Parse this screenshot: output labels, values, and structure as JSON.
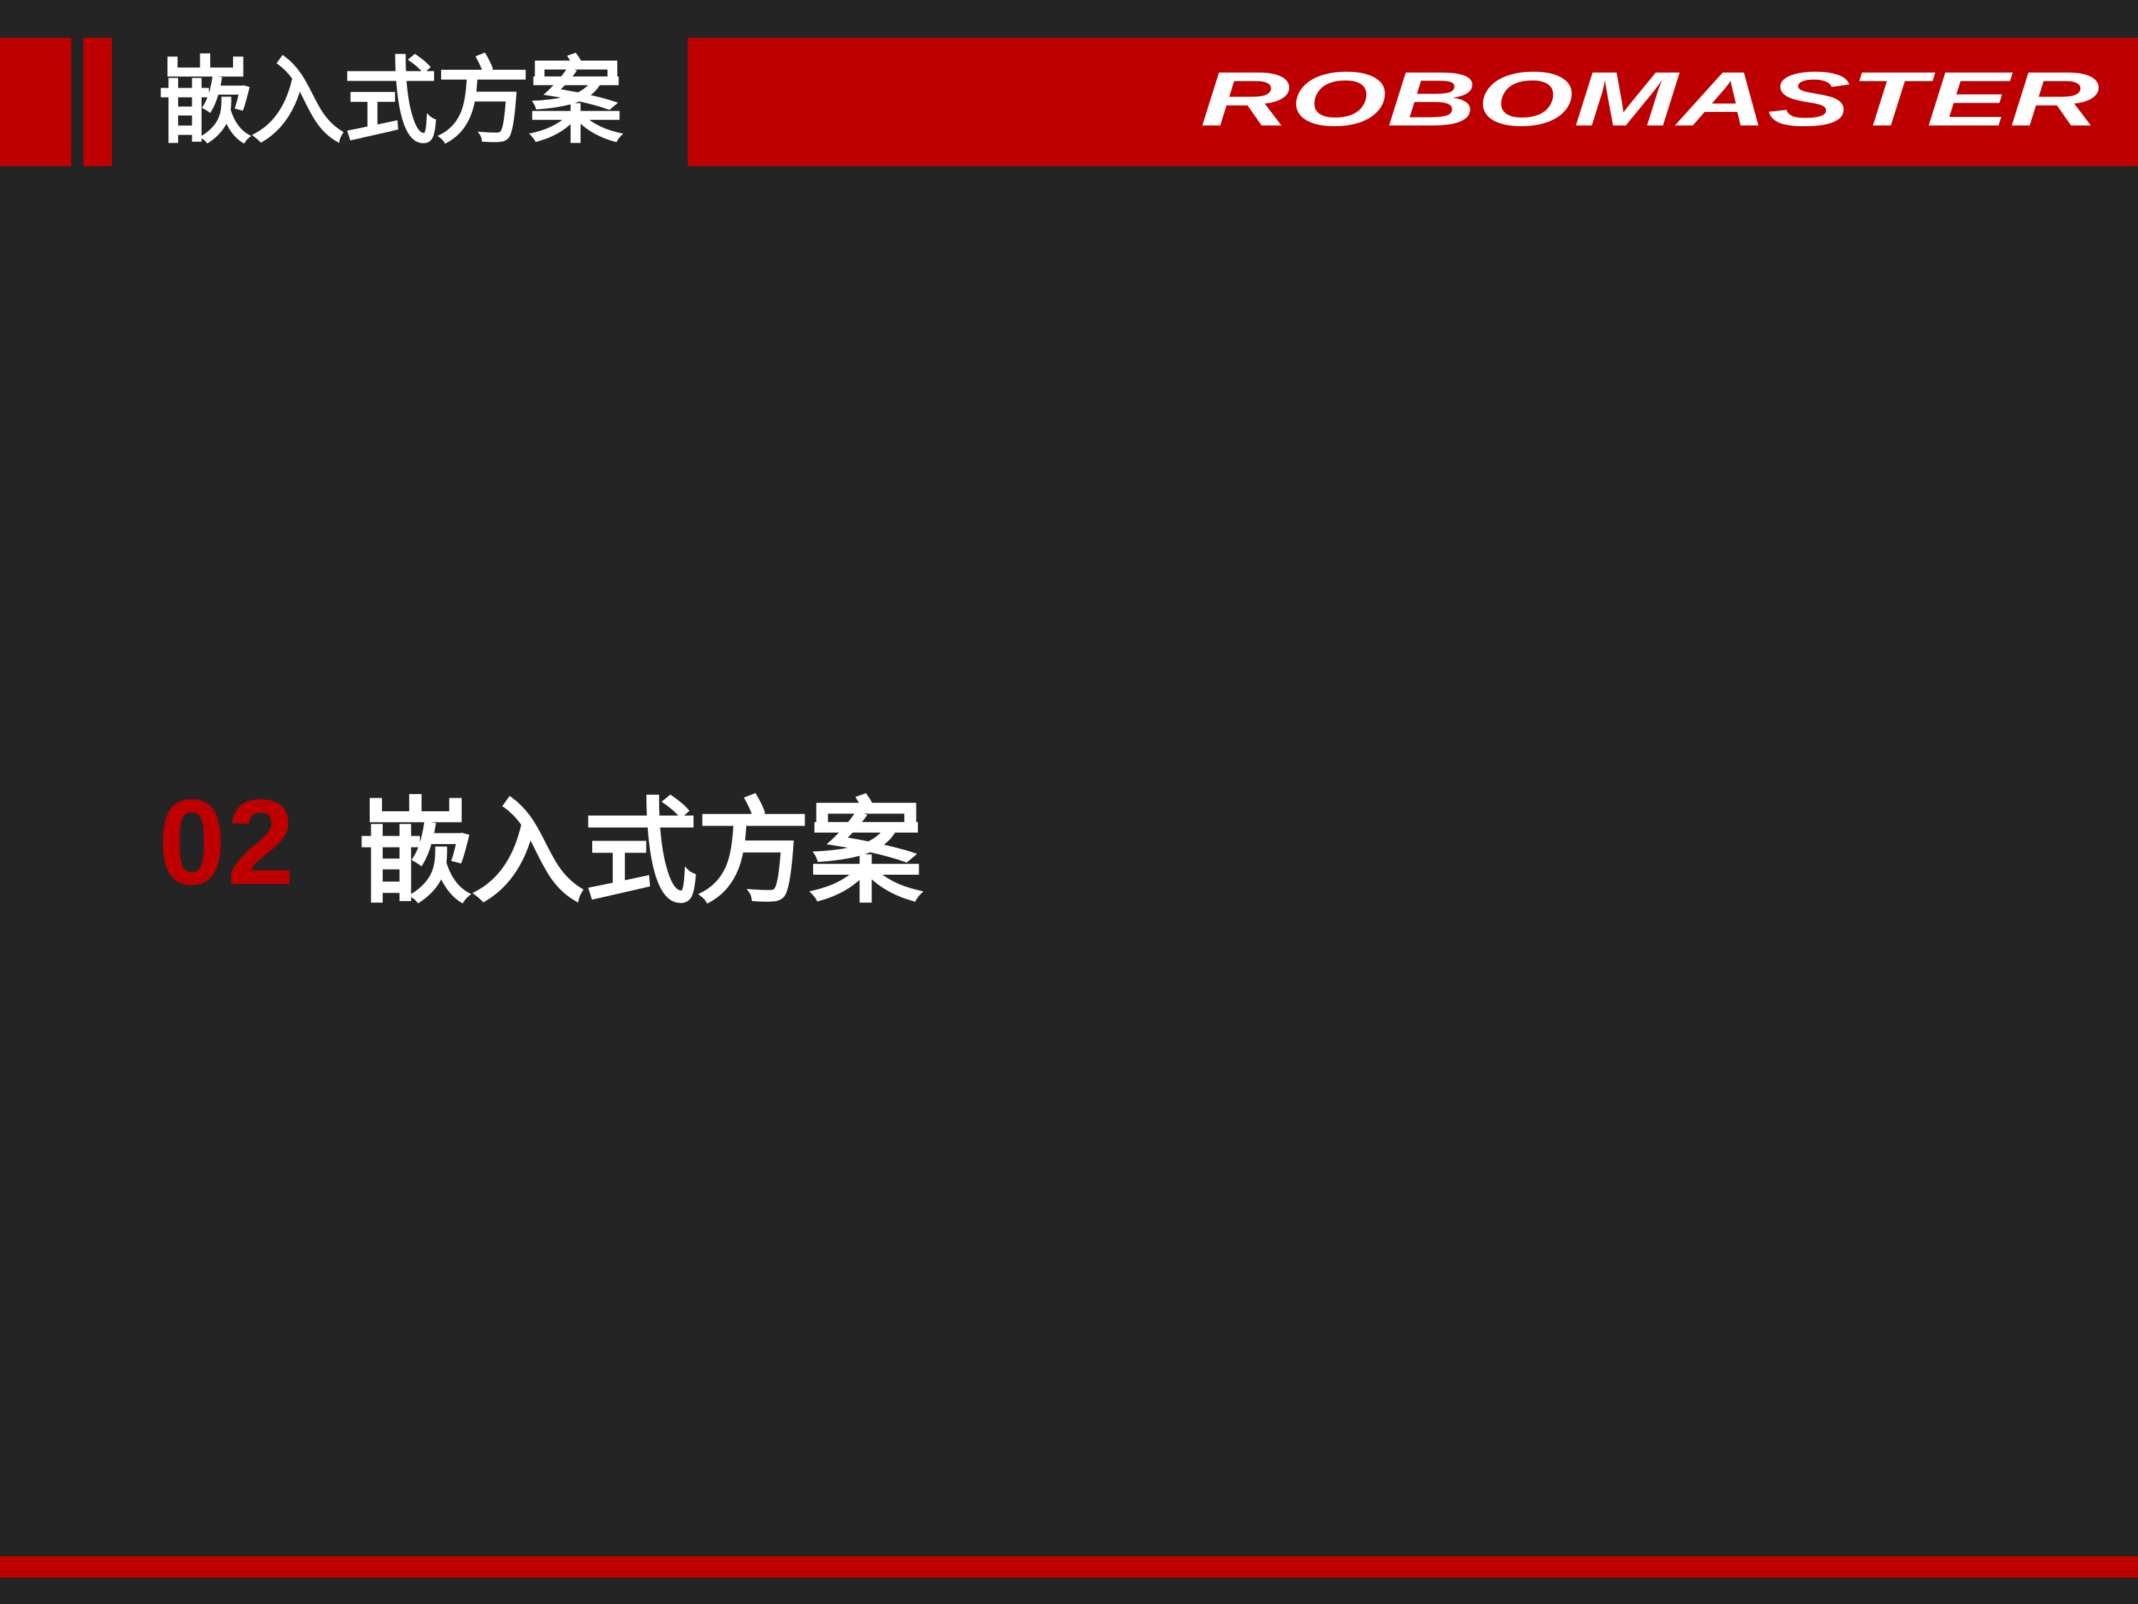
{
  "header": {
    "title": "嵌入式方案",
    "logo_text": "ROBOMASTER"
  },
  "section": {
    "number": "02",
    "title": "嵌入式方案"
  },
  "colors": {
    "background": "#242424",
    "accent": "#bf0000",
    "text": "#ffffff"
  }
}
